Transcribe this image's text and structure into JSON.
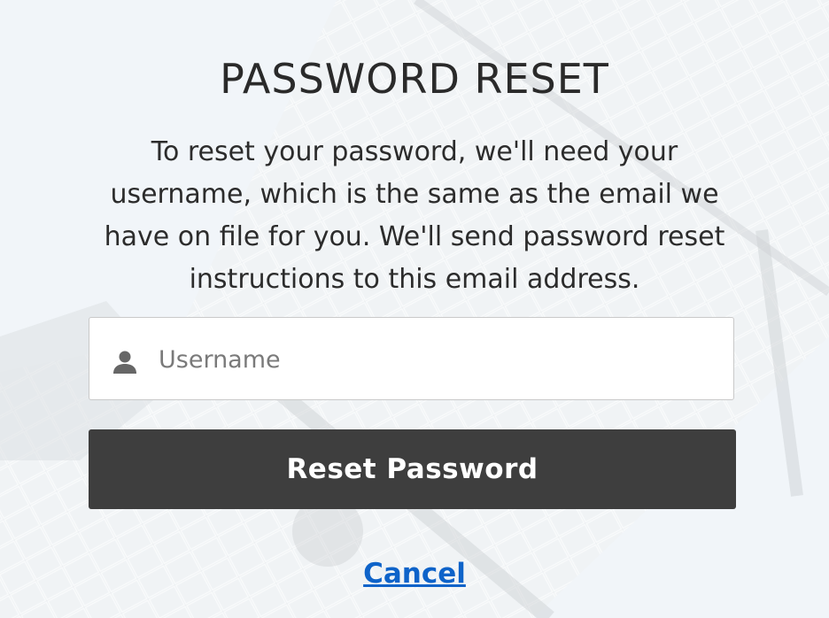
{
  "page": {
    "title": "PASSWORD RESET",
    "description": "To reset your password, we'll need your username, which is the same as the email we have on file for you. We'll send password reset instructions to this email address."
  },
  "username_field": {
    "icon": "user-icon",
    "placeholder": "Username",
    "value": ""
  },
  "actions": {
    "reset_label": "Reset Password",
    "cancel_label": "Cancel"
  },
  "colors": {
    "button_bg": "#3e3e3e",
    "link": "#0e63c9",
    "title_text": "#2a2a2a"
  }
}
